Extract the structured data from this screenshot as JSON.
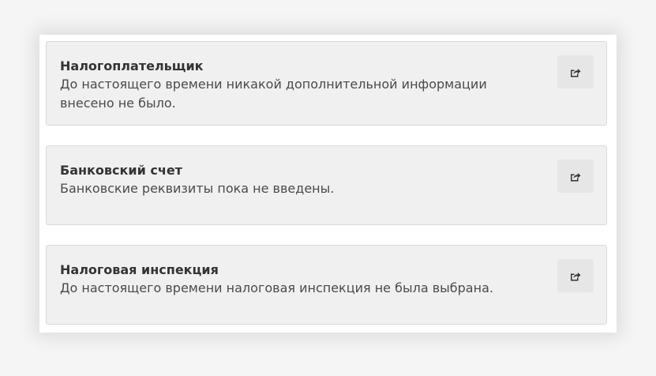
{
  "sections": [
    {
      "title": "Налогоплательщик",
      "text": "До настоящего времени никакой дополнительной информации внесено не было.",
      "icon": "share-edit-icon"
    },
    {
      "title": "Банковский счет",
      "text": "Банковские реквизиты пока не введены.",
      "icon": "share-edit-icon"
    },
    {
      "title": "Налоговая инспекция",
      "text": "До настоящего времени налоговая инспекция не была выбрана.",
      "icon": "share-edit-icon"
    }
  ],
  "colors": {
    "panel_bg": "#f0f0f0",
    "panel_border": "#d9d9d9",
    "button_bg": "#e6e6e6",
    "title_text": "#333333"
  }
}
